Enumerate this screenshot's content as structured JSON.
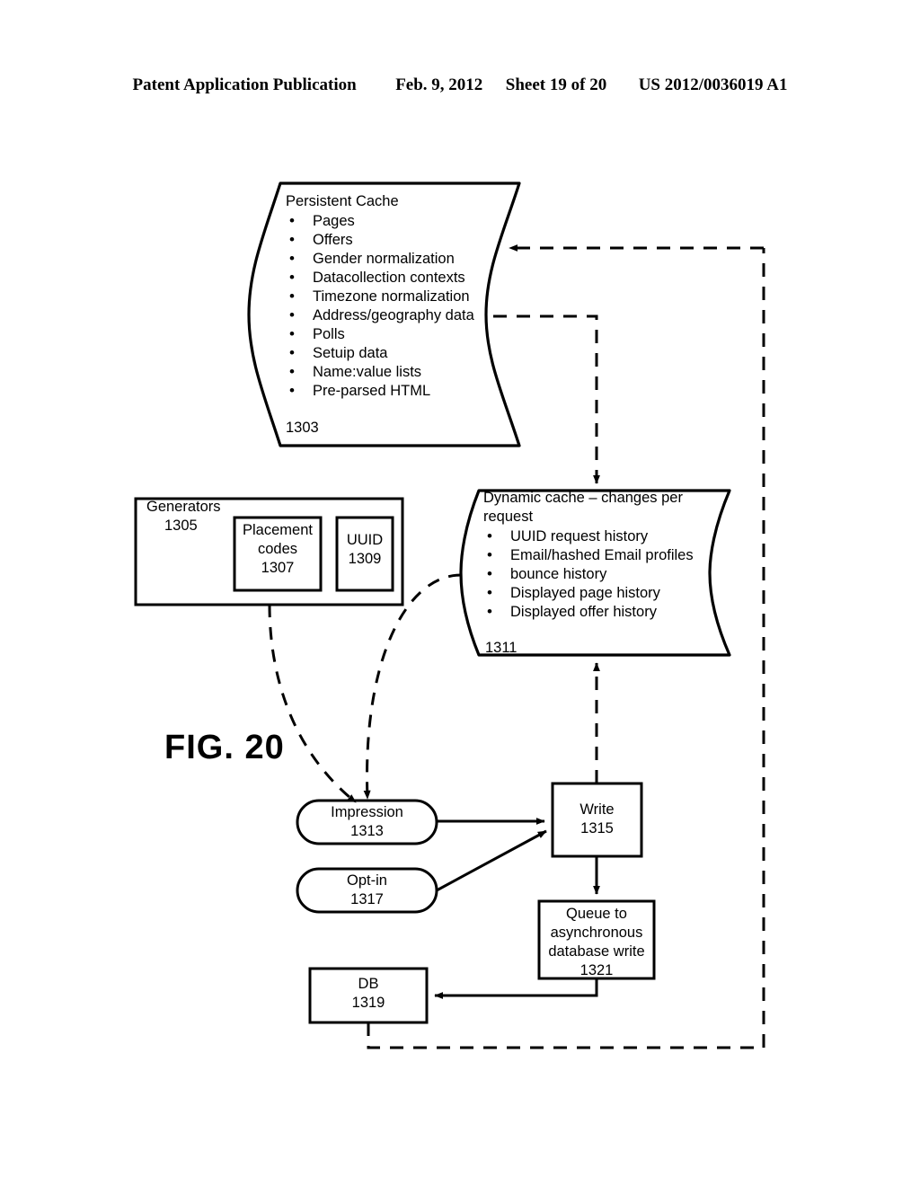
{
  "header": {
    "publication": "Patent Application Publication",
    "date": "Feb. 9, 2012",
    "sheet": "Sheet 19 of 20",
    "pub_number": "US 2012/0036019 A1"
  },
  "figure": {
    "label": "FIG. 20"
  },
  "persistent_cache": {
    "title": "Persistent Cache",
    "items": [
      "Pages",
      "Offers",
      "Gender normalization",
      "Datacollection contexts",
      "Timezone normalization",
      "Address/geography data",
      "Polls",
      "Setuip data",
      "Name:value lists",
      "Pre-parsed HTML"
    ],
    "ref": "1303"
  },
  "generators": {
    "title": "Generators",
    "ref": "1305",
    "placement_codes": {
      "line1": "Placement",
      "line2": "codes",
      "ref": "1307"
    },
    "uuid": {
      "line1": "UUID",
      "ref": "1309"
    }
  },
  "dynamic_cache": {
    "title_line1": "Dynamic cache – changes per",
    "title_line2": "request",
    "items": [
      "UUID request history",
      "Email/hashed Email profiles",
      "bounce history",
      "Displayed page history",
      "Displayed offer history"
    ],
    "ref": "1311"
  },
  "nodes": {
    "impression": {
      "label": "Impression",
      "ref": "1313"
    },
    "opt_in": {
      "label": "Opt-in",
      "ref": "1317"
    },
    "write": {
      "label": "Write",
      "ref": "1315"
    },
    "queue": {
      "line1": "Queue to",
      "line2": "asynchronous",
      "line3": "database write",
      "ref": "1321"
    },
    "db": {
      "label": "DB",
      "ref": "1319"
    }
  },
  "colors": {
    "ink": "#000000",
    "paper": "#ffffff"
  }
}
